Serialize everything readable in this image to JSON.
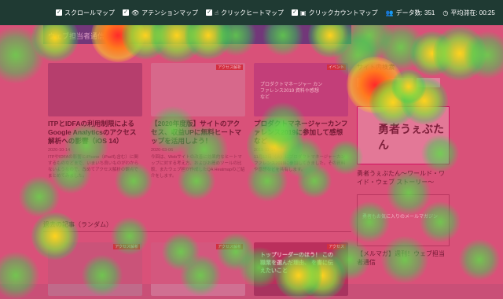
{
  "toolbar": {
    "scroll_map": "スクロールマップ",
    "attention_map": "アテンションマップ",
    "click_heat_map": "クリックヒートマップ",
    "click_count_map": "クリックカウントマップ",
    "data_count": "データ数: 351",
    "avg_stay": "平均滞在: 00:25"
  },
  "site": {
    "logo_text": "ウェブ担当者通信"
  },
  "articles": [
    {
      "title": "ITPとIDFAの利用制限によるGoogle Analyticsのアクセス解析への影響（iOS 14）",
      "date": "2020-10-14",
      "excerpt": "ITPやIDFAの影響とiPhone（iPadも含む）に関するものなどまで、いまいち良いものがわからないようなので、改めてアクセス解析の観点でまとめてみました。"
    },
    {
      "title": "【2020年度版】サイトのアクセス、収益UPに無料ヒートマップを活用しよう！",
      "date": "2020-03-06",
      "excerpt": "今回は、Webサイトの改善に効果的なヒートマップに対する考え方、およびお薦めツールの比較、またウェブ担が作成したQA Heatmapのご紹介をします。",
      "badge": "アクセス解析"
    },
    {
      "title": "プロダクトマネージャーカンファレンス2019に参加して感想など",
      "date": "2019-11-14",
      "excerpt": "11月12日（火）にプロダクトマネージャーカンファレンス2019に参加してきました。その資料や感想などを共有します。",
      "badge": "イベント",
      "thumb_text": "プロダクトマネージャー カンファレンス2019 資料や感想など"
    }
  ],
  "section": {
    "random_label": "過去の記事（ランダム）"
  },
  "bottom_cards": [
    {
      "badge": "アクセス解析"
    },
    {
      "badge": "アクセス解析"
    },
    {
      "badge": "アクセス",
      "thumb_text": "トップリーダーのほう！ この職業を選んだ理由、 を書に伝えたいこと"
    }
  ],
  "sidebar": {
    "title": "サイト内検索",
    "search_placeholder": "Google",
    "banner_text": "勇者うぇぶたん",
    "banner_caption": "勇者うぇぶたん〜ワールド・ワイド・ウェブ ストーリー〜",
    "banner2_text": "勇者もお気に入りのメールマガジン",
    "banner2_caption": "【メルマガ】週刊！ウェブ担当者通信"
  },
  "colors": {
    "toolbar_bg": "#1f3a33",
    "overlay": "#dc285a",
    "hot": "#ff2020",
    "warm": "#ffd21e",
    "cool": "#2fd64f"
  }
}
